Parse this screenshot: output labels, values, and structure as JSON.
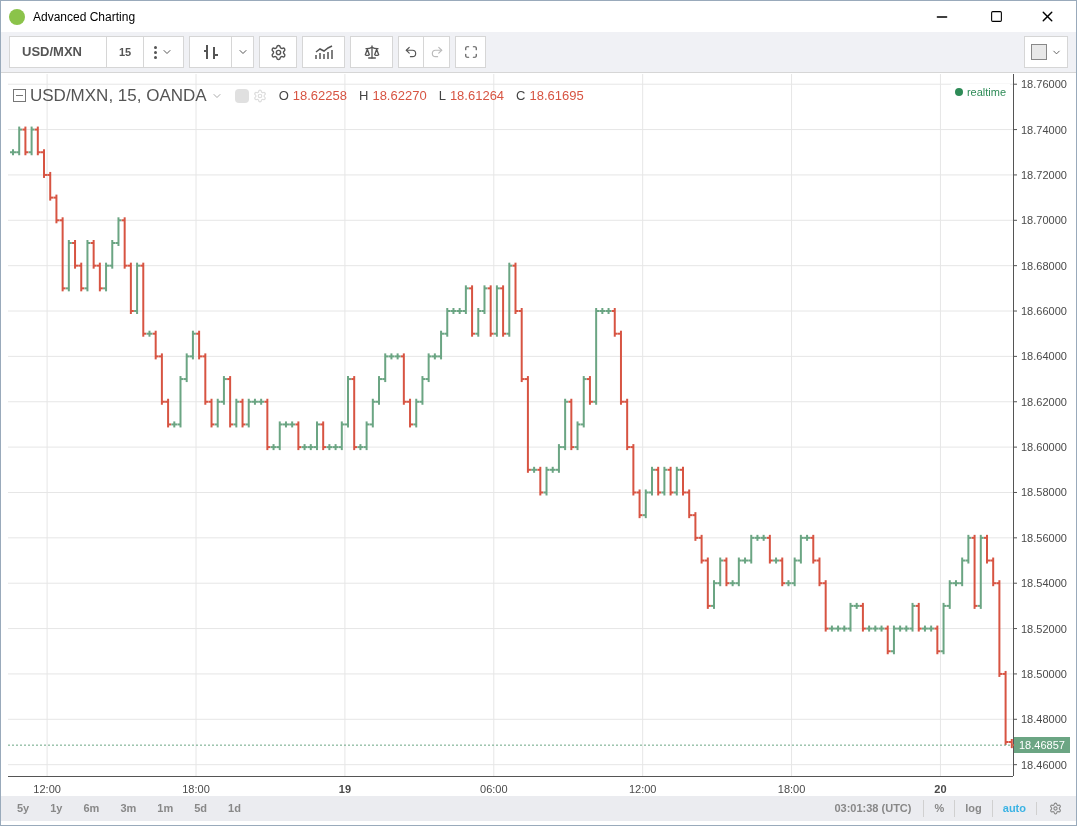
{
  "window": {
    "title": "Advanced Charting"
  },
  "toolbar": {
    "symbol": "USD/MXN",
    "interval": "15"
  },
  "legend": {
    "title": "USD/MXN, 15, OANDA",
    "status": "realtime",
    "values": [
      {
        "label": "O",
        "value": "18.62258"
      },
      {
        "label": "H",
        "value": "18.62270"
      },
      {
        "label": "L",
        "value": "18.61264"
      },
      {
        "label": "C",
        "value": "18.61695"
      }
    ]
  },
  "chart": {
    "last_price": "18.46857",
    "y_axis_labels": [
      "18.76000",
      "18.74000",
      "18.72000",
      "18.70000",
      "18.68000",
      "18.66000",
      "18.64000",
      "18.62000",
      "18.60000",
      "18.58000",
      "18.56000",
      "18.54000",
      "18.52000",
      "18.50000",
      "18.48000",
      "18.46000"
    ],
    "x_axis_labels": [
      {
        "label": "12:00",
        "kind": "time"
      },
      {
        "label": "18:00",
        "kind": "time"
      },
      {
        "label": "19",
        "kind": "day"
      },
      {
        "label": "06:00",
        "kind": "time"
      },
      {
        "label": "12:00",
        "kind": "time"
      },
      {
        "label": "18:00",
        "kind": "time"
      },
      {
        "label": "20",
        "kind": "day"
      }
    ]
  },
  "bottom_bar": {
    "ranges": [
      {
        "label": "5y"
      },
      {
        "label": "1y"
      },
      {
        "label": "6m"
      },
      {
        "label": "3m"
      },
      {
        "label": "1m"
      },
      {
        "label": "5d"
      },
      {
        "label": "1d"
      }
    ],
    "clock": "03:01:38 (UTC)",
    "options": [
      {
        "label": "%",
        "selected": false
      },
      {
        "label": "log",
        "selected": false
      },
      {
        "label": "auto",
        "selected": true
      }
    ]
  }
}
